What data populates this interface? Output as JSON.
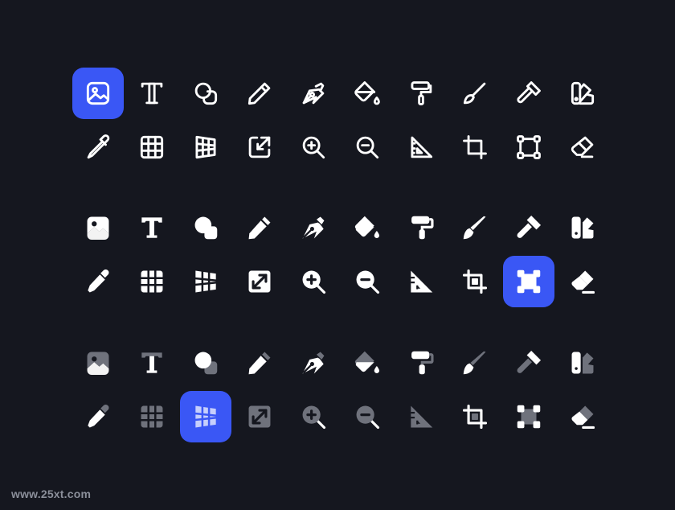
{
  "colors": {
    "background": "#15171f",
    "icon": "#ffffff",
    "duotone_secondary": "#6f727c",
    "accent": "#3a57f5"
  },
  "icon_names": [
    "image",
    "text",
    "shapes",
    "pencil",
    "pen-tool",
    "paint-bucket",
    "paint-roller",
    "brush",
    "hammer",
    "swatches",
    "eyedropper",
    "grid",
    "perspective-grid",
    "scale",
    "zoom-in",
    "zoom-out",
    "ruler-triangle",
    "crop",
    "vector-selection",
    "eraser"
  ],
  "icon_sets": [
    {
      "style": "outline",
      "active_icon": "image"
    },
    {
      "style": "solid",
      "active_icon": "vector-selection"
    },
    {
      "style": "duotone",
      "active_icon": "perspective-grid"
    }
  ],
  "watermark": "www.25xt.com"
}
